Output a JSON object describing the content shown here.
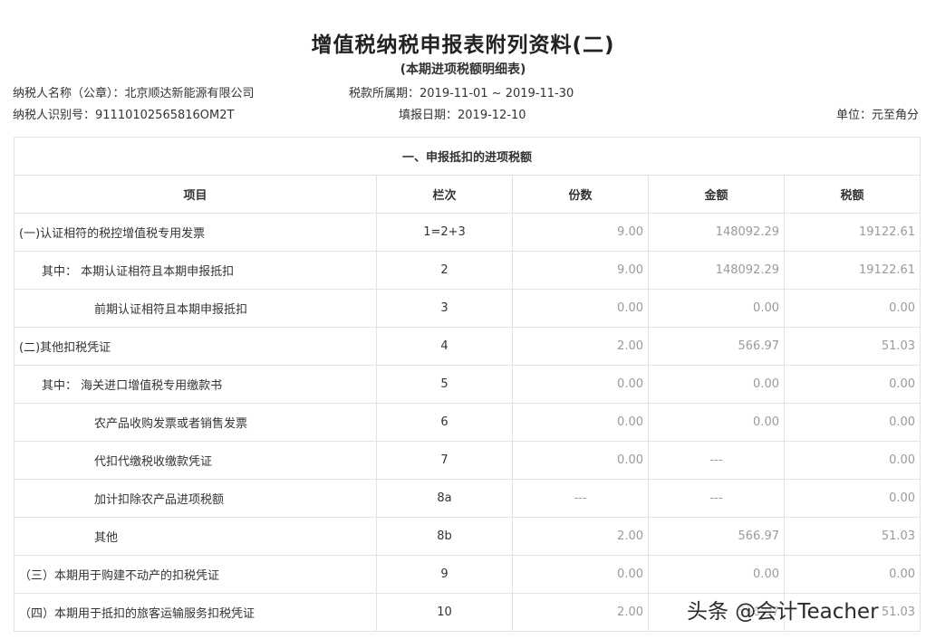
{
  "doc": {
    "title": "增值税纳税申报表附列资料(二)",
    "subtitle": "(本期进项税额明细表)"
  },
  "meta": {
    "taxpayer_name": "纳税人名称（公章）：北京顺达新能源有限公司",
    "tax_period": "税款所属期：2019-11-01 ~ 2019-11-30",
    "taxpayer_id": "纳税人识别号：91110102565816OM2T",
    "fill_date": "填报日期：2019-12-10",
    "unit": "单位：元至角分"
  },
  "table": {
    "section_title": "一、申报抵扣的进项税额",
    "headers": [
      "项目",
      "栏次",
      "份数",
      "金额",
      "税额"
    ],
    "rows": [
      {
        "item": "(一)认证相符的税控增值税专用发票",
        "col": "1=2+3",
        "count": "9.00",
        "amount": "148092.29",
        "tax": "19122.61"
      },
      {
        "item": "其中： 本期认证相符且本期申报抵扣",
        "col": "2",
        "count": "9.00",
        "amount": "148092.29",
        "tax": "19122.61"
      },
      {
        "item": "前期认证相符且本期申报抵扣",
        "col": "3",
        "count": "0.00",
        "amount": "0.00",
        "tax": "0.00"
      },
      {
        "item": "(二)其他扣税凭证",
        "col": "4",
        "count": "2.00",
        "amount": "566.97",
        "tax": "51.03"
      },
      {
        "item": "其中： 海关进口增值税专用缴款书",
        "col": "5",
        "count": "0.00",
        "amount": "0.00",
        "tax": "0.00"
      },
      {
        "item": "农产品收购发票或者销售发票",
        "col": "6",
        "count": "0.00",
        "amount": "0.00",
        "tax": "0.00"
      },
      {
        "item": "代扣代缴税收缴款凭证",
        "col": "7",
        "count": "0.00",
        "amount": "---",
        "tax": "0.00"
      },
      {
        "item": "加计扣除农产品进项税额",
        "col": "8a",
        "count": "---",
        "amount": "---",
        "tax": "0.00"
      },
      {
        "item": "其他",
        "col": "8b",
        "count": "2.00",
        "amount": "566.97",
        "tax": "51.03"
      },
      {
        "item": "（三）本期用于购建不动产的扣税凭证",
        "col": "9",
        "count": "0.00",
        "amount": "0.00",
        "tax": "0.00"
      },
      {
        "item": "（四）本期用于抵扣的旅客运输服务扣税凭证",
        "col": "10",
        "count": "2.00",
        "amount": "566.97",
        "tax": "51.03"
      }
    ]
  },
  "watermark": "头条 @会计Teacher"
}
